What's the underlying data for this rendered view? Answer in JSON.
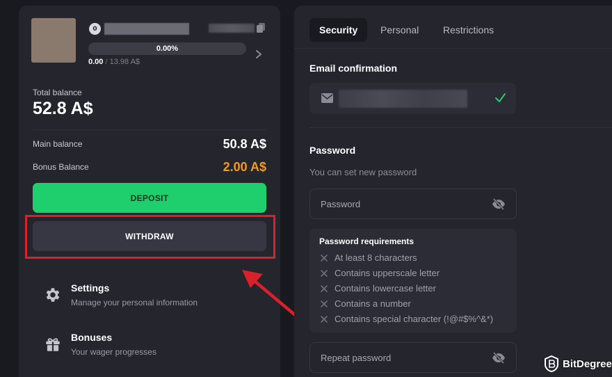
{
  "profile": {
    "level": "0",
    "progress_percent": "0.00%",
    "progress_current": "0.00",
    "progress_separator": "/",
    "progress_max": "13.98 A$",
    "progress_fraction": 0.0
  },
  "balance": {
    "total_label": "Total balance",
    "total_value": "52.8 A$",
    "main_label": "Main balance",
    "main_value": "50.8 A$",
    "bonus_label": "Bonus Balance",
    "bonus_value": "2.00 A$"
  },
  "buttons": {
    "deposit": "DEPOSIT",
    "withdraw": "WITHDRAW"
  },
  "menu": [
    {
      "title": "Settings",
      "subtitle": "Manage your personal information",
      "icon": "gear-icon"
    },
    {
      "title": "Bonuses",
      "subtitle": "Your wager progresses",
      "icon": "gift-icon"
    }
  ],
  "tabs": [
    {
      "label": "Security",
      "active": true
    },
    {
      "label": "Personal",
      "active": false
    },
    {
      "label": "Restrictions",
      "active": false
    }
  ],
  "email": {
    "title": "Email confirmation",
    "verified": true
  },
  "password": {
    "title": "Password",
    "subtitle": "You can set new password",
    "placeholder": "Password",
    "repeat_placeholder": "Repeat password",
    "requirements_title": "Password requirements",
    "requirements": [
      "At least 8 characters",
      "Contains upperscale letter",
      "Contains lowercase letter",
      "Contains a number",
      "Contains special character (!@#$%^&*)"
    ]
  },
  "watermark": {
    "brand": "BitDegree"
  },
  "colors": {
    "deposit_green": "#1fce6c",
    "bonus_orange": "#f39b1b",
    "highlight_red": "#d8212a",
    "check_green": "#1fce6c"
  }
}
